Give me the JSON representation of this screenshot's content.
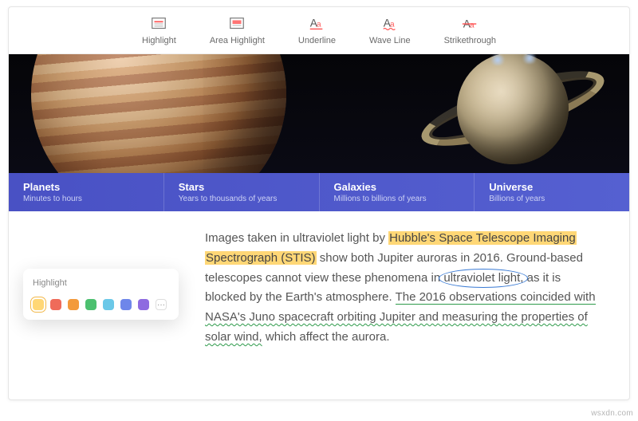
{
  "toolbar": [
    {
      "id": "highlight",
      "label": "Highlight"
    },
    {
      "id": "area-highlight",
      "label": "Area Highlight"
    },
    {
      "id": "underline",
      "label": "Underline"
    },
    {
      "id": "wave-line",
      "label": "Wave Line"
    },
    {
      "id": "strikethrough",
      "label": "Strikethrough"
    }
  ],
  "categories": [
    {
      "title": "Planets",
      "sub": "Minutes to hours"
    },
    {
      "title": "Stars",
      "sub": "Years to thousands of years"
    },
    {
      "title": "Galaxies",
      "sub": "Millions to billions of years"
    },
    {
      "title": "Universe",
      "sub": "Billions of years"
    }
  ],
  "article": {
    "t1": "Images taken in ultraviolet light by ",
    "hl1": "Hubble's Space Telescope Imaging",
    "hl2": "Spectrograph (STIS)",
    "t2": " show both Jupiter auroras in 2016. Ground-based telescopes cannot view these phenomena in ",
    "circled": "ultraviolet light,",
    "t3": " as it is blocked by  the Earth's atmosphere. ",
    "u1": "The 2016 observations coincided with",
    "w1": "NASA's Juno  spacecraft orbiting Jupiter and measuring the properties of",
    "w2": "solar wind,",
    "t4": " which affect the aurora."
  },
  "color_popover": {
    "label": "Highlight",
    "colors": [
      "#ffd776",
      "#ef6b5a",
      "#f39a3b",
      "#4cc06f",
      "#6bc8e8",
      "#6e86ea",
      "#8e6be0"
    ],
    "selected_index": 0,
    "more_label": "···"
  },
  "watermark": "wsxdn.com"
}
